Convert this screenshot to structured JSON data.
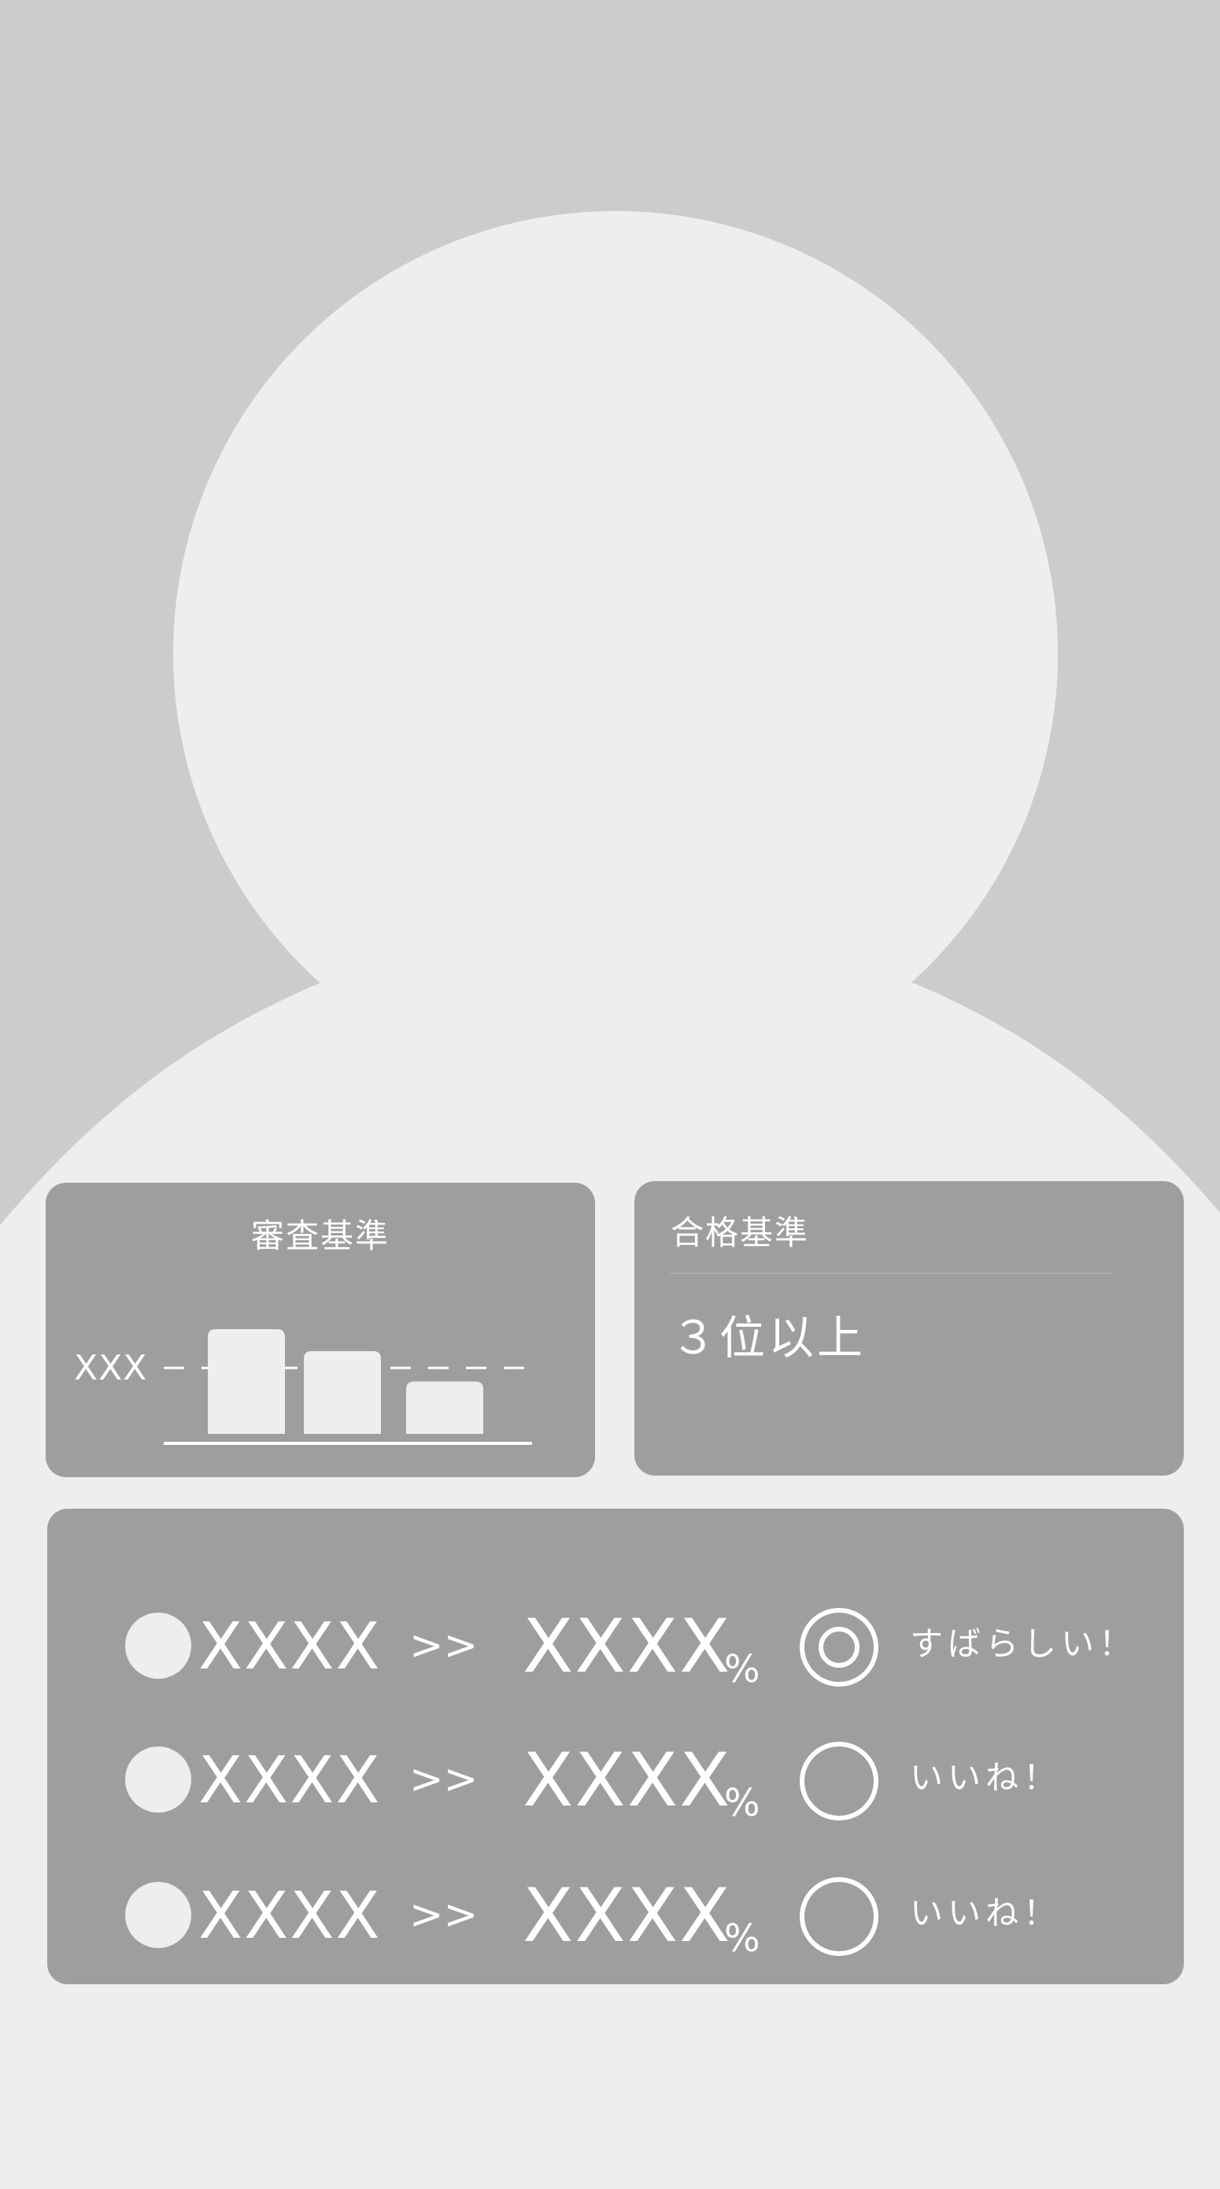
{
  "colors": {
    "background": "#eeeeee",
    "silhouette_bg": "#cccccc",
    "card": "#9e9e9e",
    "text": "#ffffff"
  },
  "hero": {
    "icon": "person-placeholder-icon"
  },
  "criteria_card": {
    "title": "審査基準",
    "threshold_label": "XXX"
  },
  "chart_data": {
    "type": "bar",
    "title": "審査基準",
    "categories": [
      "",
      "",
      ""
    ],
    "values": [
      1.0,
      0.79,
      0.5
    ],
    "threshold_label": "XXX",
    "threshold_value": 0.63,
    "ylim": [
      0,
      1.0
    ],
    "grid": false
  },
  "pass_card": {
    "title": "合格基準",
    "value": "３位以上"
  },
  "results": [
    {
      "from": "XXXX",
      "arrow": ">>",
      "to": "XXXX",
      "unit": "%",
      "mark": "double-circle-icon",
      "comment": "すばらしい！"
    },
    {
      "from": "XXXX",
      "arrow": ">>",
      "to": "XXXX",
      "unit": "%",
      "mark": "circle-icon",
      "comment": "いいね！"
    },
    {
      "from": "XXXX",
      "arrow": ">>",
      "to": "XXXX",
      "unit": "%",
      "mark": "circle-icon",
      "comment": "いいね！"
    }
  ]
}
